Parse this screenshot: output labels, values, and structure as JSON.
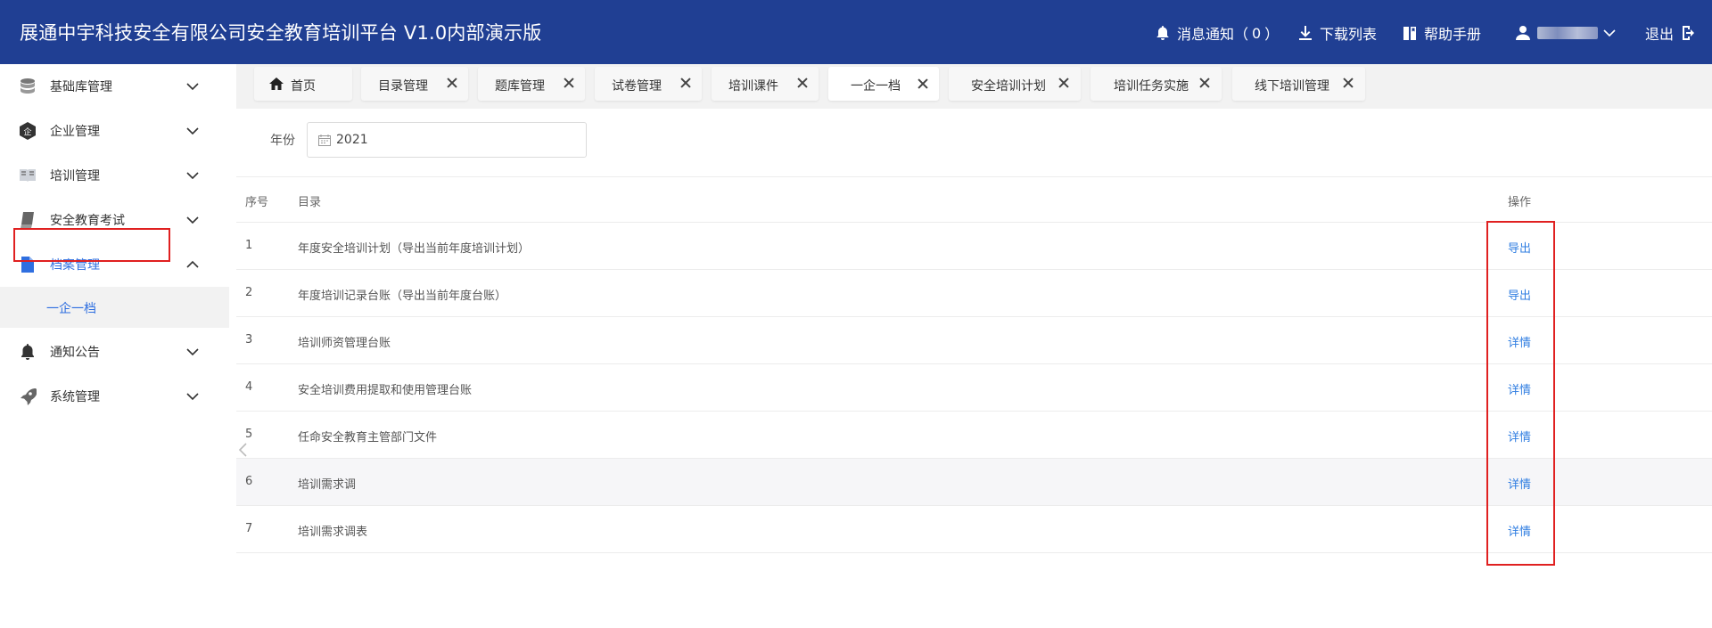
{
  "header": {
    "title": "展通中宇科技安全有限公司安全教育培训平台 V1.0内部演示版",
    "notifications_label": "消息通知（",
    "notifications_count": "0",
    "notifications_close": "）",
    "downloads_label": "下载列表",
    "help_label": "帮助手册",
    "logout_label": "退出",
    "bg_color": "#203f93"
  },
  "sidebar": {
    "items": [
      {
        "label": "基础库管理",
        "icon": "database-icon"
      },
      {
        "label": "企业管理",
        "icon": "enterprise-icon"
      },
      {
        "label": "培训管理",
        "icon": "training-icon"
      },
      {
        "label": "安全教育考试",
        "icon": "book-icon"
      },
      {
        "label": "档案管理",
        "icon": "file-icon",
        "expanded": true
      },
      {
        "label": "通知公告",
        "icon": "bell-icon"
      },
      {
        "label": "系统管理",
        "icon": "rocket-icon"
      }
    ],
    "sub_item": "一企一档",
    "active_color": "#2f6fe0"
  },
  "tabs": [
    {
      "label": "首页",
      "closable": false
    },
    {
      "label": "目录管理",
      "closable": true
    },
    {
      "label": "题库管理",
      "closable": true
    },
    {
      "label": "试卷管理",
      "closable": true
    },
    {
      "label": "培训课件",
      "closable": true
    },
    {
      "label": "一企一档",
      "closable": true,
      "active": true
    },
    {
      "label": "安全培训计划",
      "closable": true
    },
    {
      "label": "培训任务实施",
      "closable": true
    },
    {
      "label": "线下培训管理",
      "closable": true
    }
  ],
  "filter": {
    "label": "年份",
    "year_value": "2021"
  },
  "table": {
    "columns": {
      "no": "序号",
      "dir": "目录",
      "op": "操作"
    },
    "rows": [
      {
        "no": "1",
        "dir": "年度安全培训计划（导出当前年度培训计划）",
        "op": "导出"
      },
      {
        "no": "2",
        "dir": "年度培训记录台账（导出当前年度台账）",
        "op": "导出"
      },
      {
        "no": "3",
        "dir": "培训师资管理台账",
        "op": "详情"
      },
      {
        "no": "4",
        "dir": "安全培训费用提取和使用管理台账",
        "op": "详情"
      },
      {
        "no": "5",
        "dir": "任命安全教育主管部门文件",
        "op": "详情"
      },
      {
        "no": "6",
        "dir": "培训需求调",
        "op": "详情"
      },
      {
        "no": "7",
        "dir": "培训需求调表",
        "op": "详情"
      }
    ]
  },
  "highlight_color": "#e02020",
  "link_color": "#2f7de1"
}
